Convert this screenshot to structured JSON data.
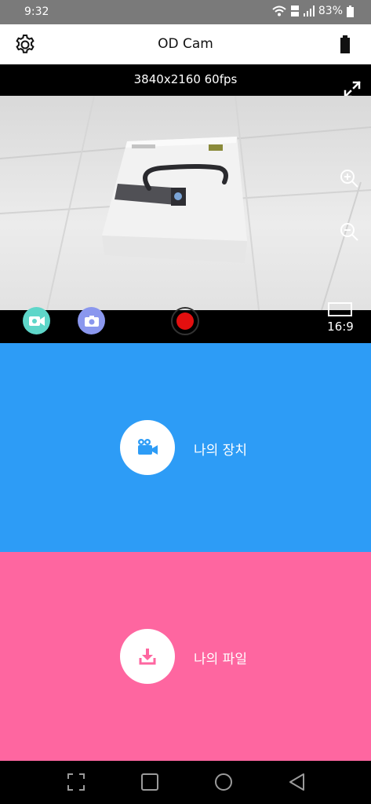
{
  "status_bar": {
    "time": "9:32",
    "battery_percent": "83%",
    "icons": [
      "wifi-icon",
      "data-icon",
      "signal-icon",
      "battery-icon"
    ]
  },
  "app_bar": {
    "title": "OD Cam",
    "left_icon": "gear-icon",
    "right_icon": "battery-icon"
  },
  "camera": {
    "resolution_label": "3840x2160 60fps",
    "aspect_ratio_label": "16:9",
    "controls": [
      "video-mode-icon",
      "photo-mode-icon",
      "record-icon",
      "zoom-in-icon",
      "zoom-out-icon",
      "fullscreen-icon"
    ]
  },
  "panels": {
    "device": {
      "label": "나의 장치",
      "icon": "video-camera-icon",
      "color": "#2d9cf6"
    },
    "files": {
      "label": "나의 파일",
      "icon": "download-icon",
      "color": "#fe66a0"
    }
  },
  "colors": {
    "record": "#e30f0f",
    "video_mode": "#5ed6c9",
    "photo_mode": "#8a97ee"
  },
  "nav_bar": {
    "buttons": [
      "screenshot-icon",
      "recents-icon",
      "home-icon",
      "back-icon"
    ]
  }
}
